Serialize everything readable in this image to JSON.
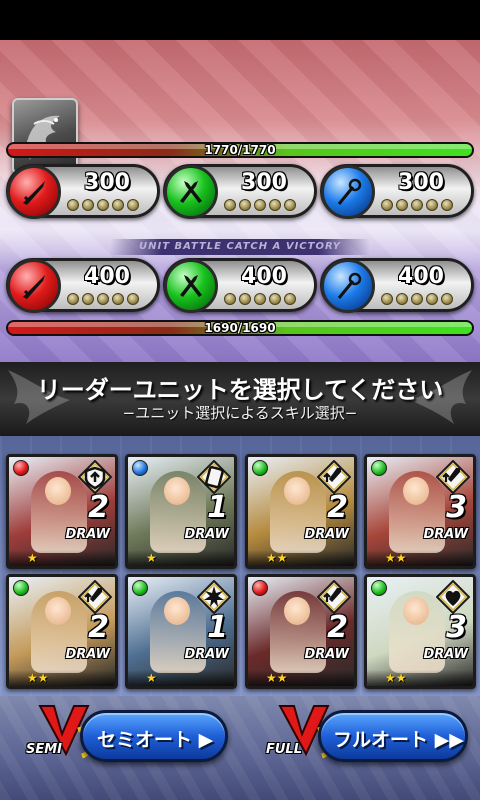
{
  "enemy": {
    "hp_text": "1770/1770",
    "hp_fraction": 1.0,
    "stats": [
      {
        "element": "red",
        "icon": "sword-icon",
        "value": "300"
      },
      {
        "element": "green",
        "icon": "twin-blades-icon",
        "value": "300"
      },
      {
        "element": "blue",
        "icon": "staff-icon",
        "value": "300"
      }
    ]
  },
  "banner_text": "UNIT BATTLE CATCH A VICTORY",
  "player": {
    "hp_text": "1690/1690",
    "hp_fraction": 1.0,
    "stats": [
      {
        "element": "red",
        "icon": "sword-icon",
        "value": "400"
      },
      {
        "element": "green",
        "icon": "twin-blades-icon",
        "value": "400"
      },
      {
        "element": "blue",
        "icon": "staff-icon",
        "value": "400"
      }
    ]
  },
  "title": {
    "main": "リーダーユニットを選択してください",
    "sub": "−ユニット選択によるスキル選択−"
  },
  "cards": [
    {
      "gem": "red",
      "skill_icon": "shield-up-icon",
      "count": "2",
      "draw": "DRAW",
      "stars": "★",
      "tone": "#9e3d3a"
    },
    {
      "gem": "blue",
      "skill_icon": "card-icon",
      "count": "1",
      "draw": "DRAW",
      "stars": "★",
      "tone": "#6f7a5a"
    },
    {
      "gem": "green",
      "skill_icon": "sword-up-icon",
      "count": "2",
      "draw": "DRAW",
      "stars": "★★",
      "tone": "#b58a3e"
    },
    {
      "gem": "green",
      "skill_icon": "sword-up-icon",
      "count": "3",
      "draw": "DRAW",
      "stars": "★★",
      "tone": "#a7463a"
    },
    {
      "gem": "green",
      "skill_icon": "sword-up-icon",
      "count": "2",
      "draw": "DRAW",
      "stars": "★★",
      "tone": "#c49a5a"
    },
    {
      "gem": "green",
      "skill_icon": "burst-icon",
      "count": "1",
      "draw": "DRAW",
      "stars": "★",
      "tone": "#4f6f92"
    },
    {
      "gem": "red",
      "skill_icon": "sword-up-icon",
      "count": "2",
      "draw": "DRAW",
      "stars": "★★",
      "tone": "#6b2a2a"
    },
    {
      "gem": "green",
      "skill_icon": "heart-icon",
      "count": "3",
      "draw": "DRAW",
      "stars": "★★",
      "tone": "#cfd8c0"
    }
  ],
  "buttons": {
    "semi_tag": "SEMI",
    "semi_label": "セミオート ▶",
    "full_tag": "FULL",
    "full_label": "フルオート ▶▶"
  }
}
